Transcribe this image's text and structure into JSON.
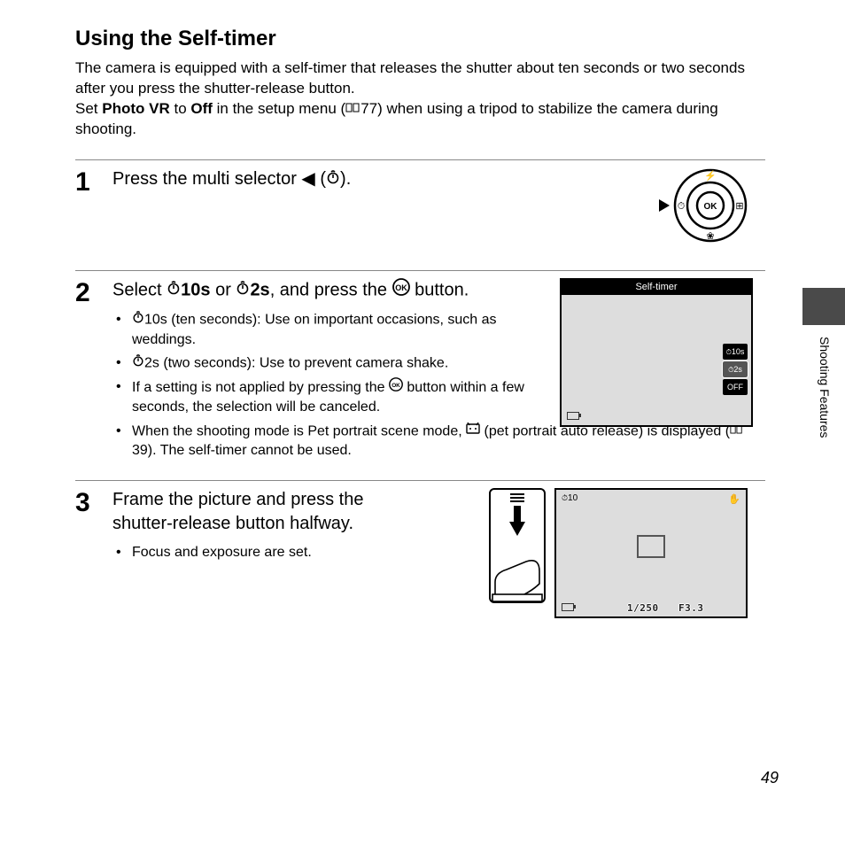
{
  "title": "Using the Self-timer",
  "intro_p1": "The camera is equipped with a self-timer that releases the shutter about ten seconds or two seconds after you press the shutter-release button.",
  "intro_p2a": "Set ",
  "intro_p2b": "Photo VR",
  "intro_p2c": " to ",
  "intro_p2d": "Off",
  "intro_p2e": " in the setup menu (",
  "intro_p2ref": "77",
  "intro_p2f": ") when using a tripod to stabilize the camera during shooting.",
  "steps": {
    "s1": {
      "num": "1",
      "heading_a": "Press the multi selector ",
      "heading_b": " (",
      "heading_c": ")."
    },
    "s2": {
      "num": "2",
      "heading_a": "Select ",
      "heading_b": "10s",
      "heading_c": " or ",
      "heading_d": "2s",
      "heading_e": ", and press the ",
      "heading_f": " button.",
      "b1a": "10s",
      "b1b": " (ten seconds): Use on important occasions, such as weddings.",
      "b2a": "2s",
      "b2b": " (two seconds): Use to prevent camera shake.",
      "b3a": "If a setting is not applied by pressing the ",
      "b3b": " button within a few seconds, the selection will be canceled.",
      "b4a": "When the shooting mode is ",
      "b4b": "Pet portrait",
      "b4c": " scene mode, ",
      "b4d": " (pet portrait auto release) is displayed (",
      "b4ref": "39",
      "b4e": "). The self-timer cannot be used.",
      "lcd_title": "Self-timer",
      "lcd_opt1": "10s",
      "lcd_opt2": "2s",
      "lcd_opt3": "OFF"
    },
    "s3": {
      "num": "3",
      "heading": "Frame the picture and press the shutter-release button halfway.",
      "b1": "Focus and exposure are set.",
      "lcd_tl": "10",
      "lcd_shutter": "1/250",
      "lcd_fnum": "F3.3"
    }
  },
  "side_label": "Shooting Features",
  "page_number": "49"
}
